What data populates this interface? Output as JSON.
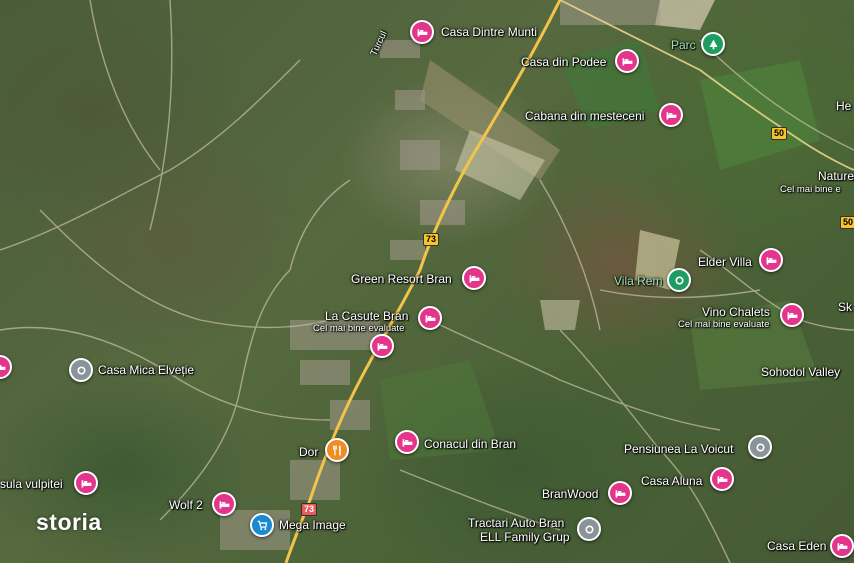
{
  "brand": {
    "logo_text": "storia"
  },
  "map": {
    "labels": [
      {
        "id": "turcul",
        "text": "Turcul"
      },
      {
        "id": "casa-dintre-munti",
        "text": "Casa Dintre Munti"
      },
      {
        "id": "casa-din-podee",
        "text": "Casa din Podee"
      },
      {
        "id": "parc",
        "text": "Parc"
      },
      {
        "id": "cabana-din-mesteceni",
        "text": "Cabana din mesteceni"
      },
      {
        "id": "he",
        "text": "He"
      },
      {
        "id": "nature-n",
        "text": "Nature N"
      },
      {
        "id": "nature-n-sub",
        "text": "Cel mai bine e"
      },
      {
        "id": "elder-villa",
        "text": "Elder Villa"
      },
      {
        "id": "vila-rem",
        "text": "Vila Rem"
      },
      {
        "id": "green-resort-bran",
        "text": "Green Resort Bran"
      },
      {
        "id": "vino-chalets",
        "text": "Vino Chalets"
      },
      {
        "id": "vino-chalets-sub",
        "text": "Cel mai bine evaluate"
      },
      {
        "id": "sk",
        "text": "Sk"
      },
      {
        "id": "la-casute-bran",
        "text": "La Casute Bran"
      },
      {
        "id": "la-casute-bran-sub",
        "text": "Cel mai bine evaluate"
      },
      {
        "id": "sohodol-valley",
        "text": "Sohodol Valley"
      },
      {
        "id": "casa-mica-elvetie",
        "text": "Casa Mica Elveție"
      },
      {
        "id": "conacul-din-bran",
        "text": "Conacul din Bran"
      },
      {
        "id": "pensiunea-la-voicut",
        "text": "Pensiunea La Voicut"
      },
      {
        "id": "dor",
        "text": "Dor"
      },
      {
        "id": "casuta-vulpitei",
        "text": "sula vulpitei"
      },
      {
        "id": "casa-aluna",
        "text": "Casa Aluna"
      },
      {
        "id": "branwood",
        "text": "BranWood"
      },
      {
        "id": "wolf-2",
        "text": "Wolf 2"
      },
      {
        "id": "mega-image",
        "text": "Mega Image"
      },
      {
        "id": "tractari-auto-bran",
        "text": "Tractari Auto Bran"
      },
      {
        "id": "ell-family-grup",
        "text": "ELL Family Grup"
      },
      {
        "id": "casa-eden",
        "text": "Casa Eden"
      }
    ],
    "road_shields": [
      {
        "id": "r73a",
        "text": "73"
      },
      {
        "id": "r73b",
        "text": "73"
      },
      {
        "id": "r50",
        "text": "50"
      },
      {
        "id": "r50b",
        "text": "50"
      }
    ],
    "pins": [
      {
        "id": "casa-dintre-munti",
        "type": "hotel-icon"
      },
      {
        "id": "casa-din-podee",
        "type": "hotel-icon"
      },
      {
        "id": "parc",
        "type": "park-icon"
      },
      {
        "id": "cabana-din-mesteceni",
        "type": "hotel-icon"
      },
      {
        "id": "elder-villa",
        "type": "hotel-icon"
      },
      {
        "id": "vila-rem",
        "type": "place-icon"
      },
      {
        "id": "green-resort-bran",
        "type": "hotel-icon"
      },
      {
        "id": "vino-chalets",
        "type": "hotel-icon"
      },
      {
        "id": "la-casute-bran",
        "type": "hotel-icon"
      },
      {
        "id": "hotel-mid",
        "type": "hotel-icon"
      },
      {
        "id": "casa-mica-elvetie",
        "type": "place-icon"
      },
      {
        "id": "left-edge",
        "type": "hotel-icon"
      },
      {
        "id": "conacul-din-bran",
        "type": "hotel-icon"
      },
      {
        "id": "pensiunea-la-voicut",
        "type": "place-icon"
      },
      {
        "id": "dor",
        "type": "restaurant-icon"
      },
      {
        "id": "casuta-vulpitei",
        "type": "hotel-icon"
      },
      {
        "id": "casa-aluna",
        "type": "hotel-icon"
      },
      {
        "id": "branwood",
        "type": "hotel-icon"
      },
      {
        "id": "wolf-2",
        "type": "hotel-icon"
      },
      {
        "id": "mega-image",
        "type": "shopping-cart-icon"
      },
      {
        "id": "tractari-auto-bran",
        "type": "place-icon"
      },
      {
        "id": "casa-eden",
        "type": "hotel-icon"
      }
    ],
    "colors": {
      "hotel": "#e3358b",
      "poi": "#8a929a",
      "park": "#1e9d63",
      "food": "#ef8c22",
      "shop": "#1a8ad0",
      "road": "#f2c44a"
    }
  }
}
